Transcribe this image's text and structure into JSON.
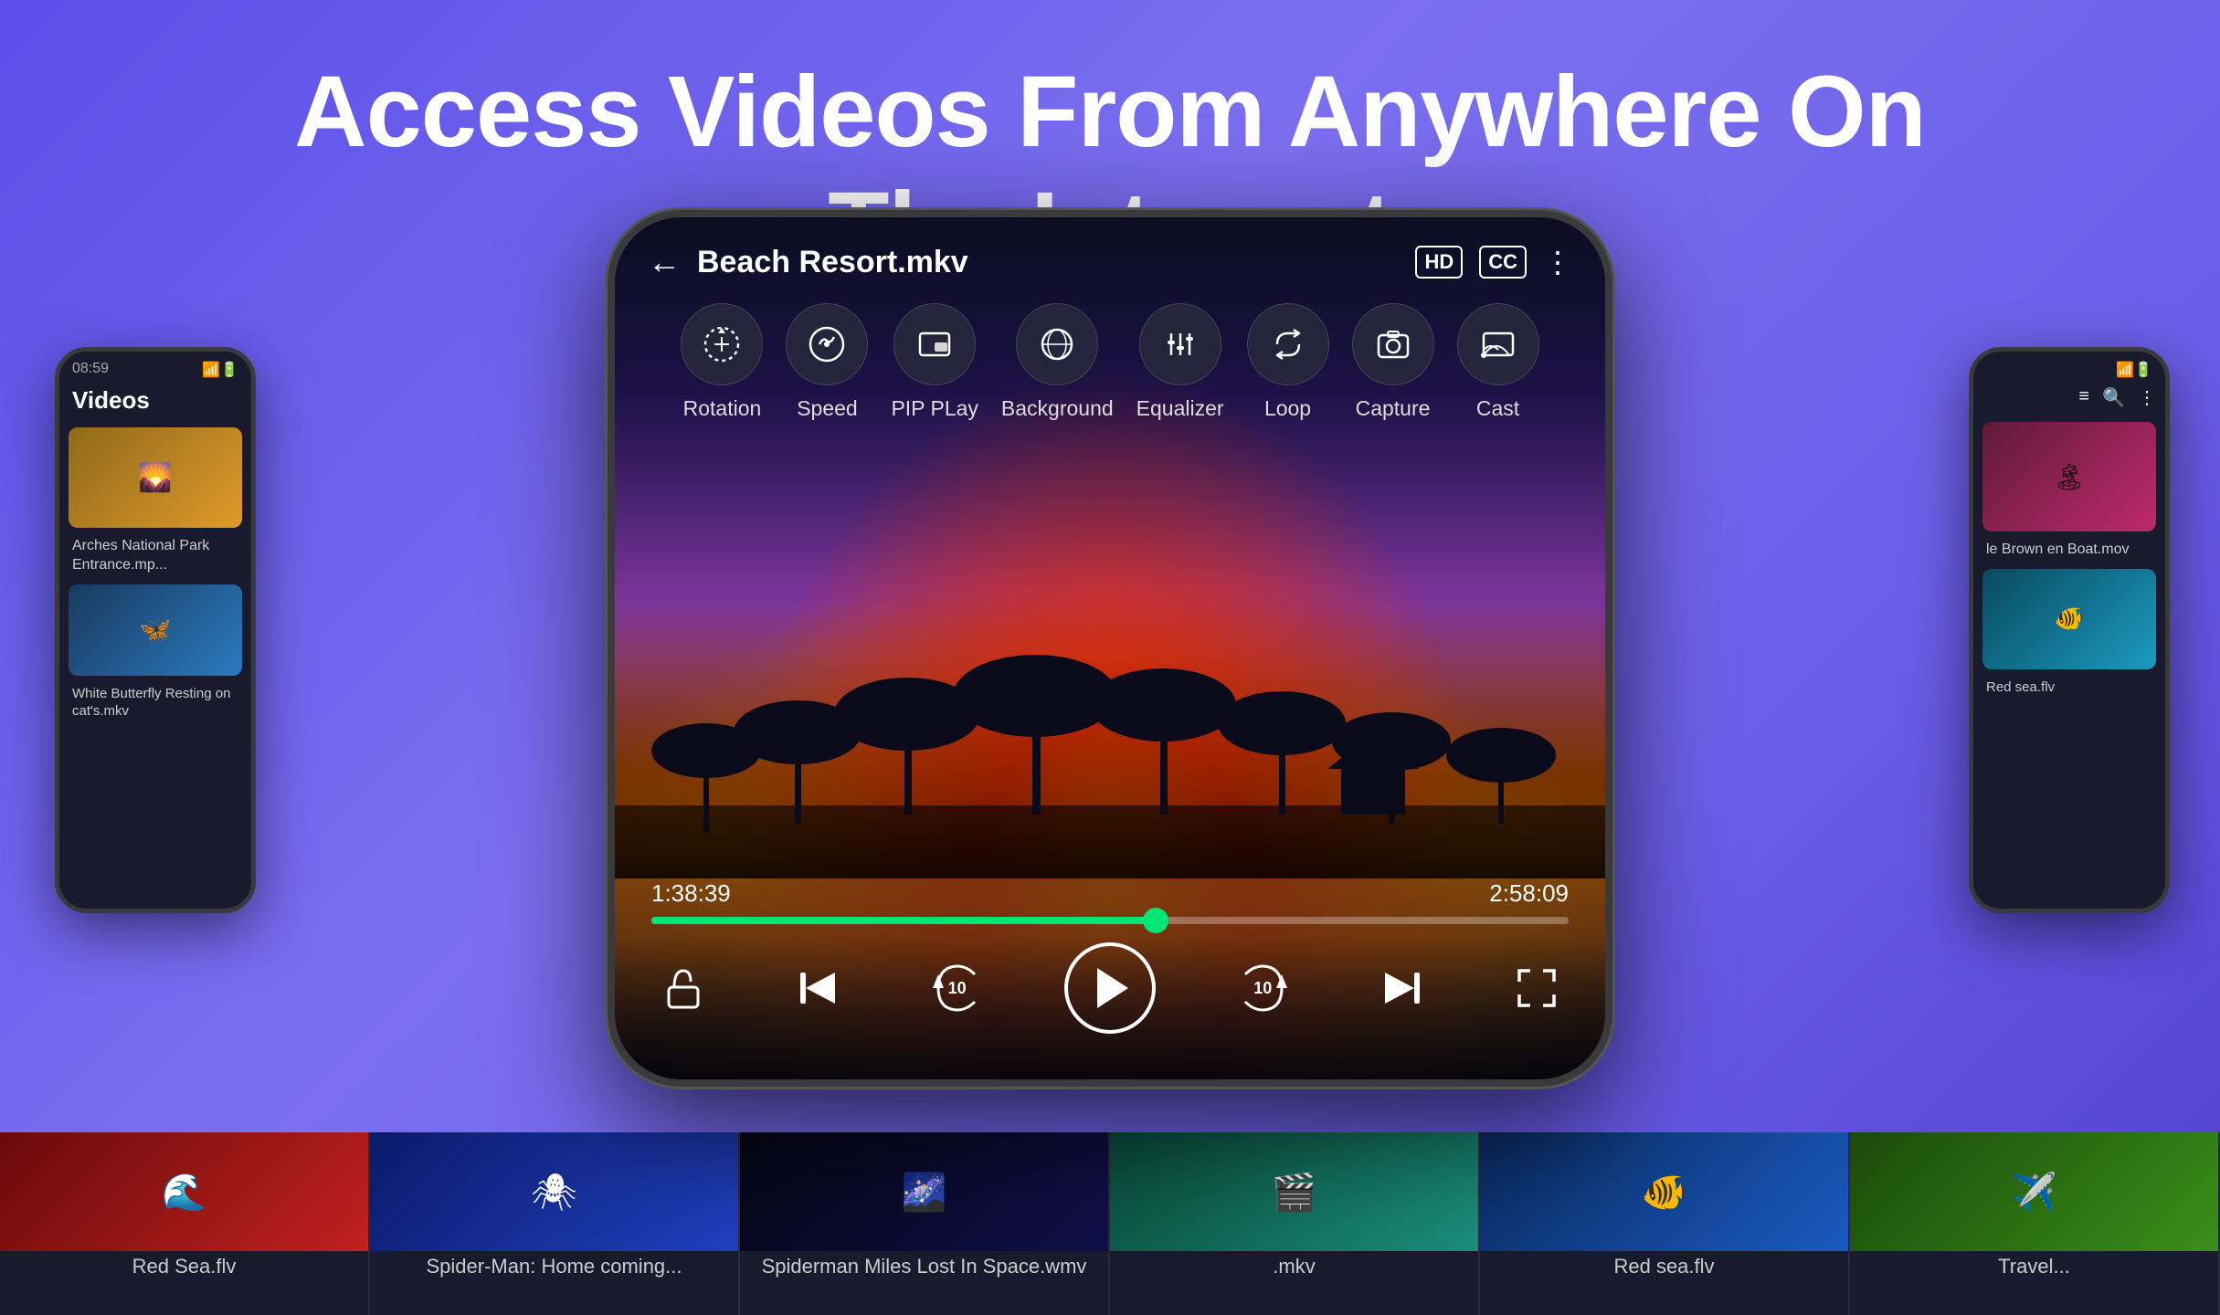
{
  "hero": {
    "title_line1": "Access Videos From Anywhere On",
    "title_line2": "The Internet"
  },
  "player": {
    "title": "Beach Resort.mkv",
    "badge_hd": "HD",
    "badge_cc": "CC",
    "time_current": "1:38:39",
    "time_total": "2:58:09",
    "progress_percent": 55,
    "controls": [
      {
        "id": "rotation",
        "label": "Rotation",
        "icon": "↻"
      },
      {
        "id": "speed",
        "label": "Speed",
        "icon": "◎"
      },
      {
        "id": "pip",
        "label": "PIP PLay",
        "icon": "▣"
      },
      {
        "id": "background",
        "label": "Background",
        "icon": "🎧"
      },
      {
        "id": "equalizer",
        "label": "Equalizer",
        "icon": "⫶"
      },
      {
        "id": "loop",
        "label": "Loop",
        "icon": "🔁"
      },
      {
        "id": "capture",
        "label": "Capture",
        "icon": "⊙"
      },
      {
        "id": "cast",
        "label": "Cast",
        "icon": "⊟"
      }
    ]
  },
  "left_phone": {
    "status_time": "08:59",
    "title": "Videos",
    "video1_label": "Arches National Park Entrance.mp...",
    "video2_label": "White Butterfly Resting on cat's.mkv"
  },
  "right_phone": {
    "video1_label": "le Brown\nen Boat.mov",
    "video2_label": ""
  },
  "filmstrip": {
    "items": [
      {
        "label": "Red Sea.flv",
        "color": "thumb-red"
      },
      {
        "label": "Spider-Man: Home coming...",
        "color": "thumb-blue"
      },
      {
        "label": "Spiderman Miles Lost In Space.wmv",
        "color": "thumb-space"
      },
      {
        "label": ".mkv",
        "color": "thumb-teal"
      },
      {
        "label": "Red sea.flv",
        "color": "thumb-underwater"
      },
      {
        "label": "Travel...",
        "color": "thumb-travel"
      }
    ]
  }
}
